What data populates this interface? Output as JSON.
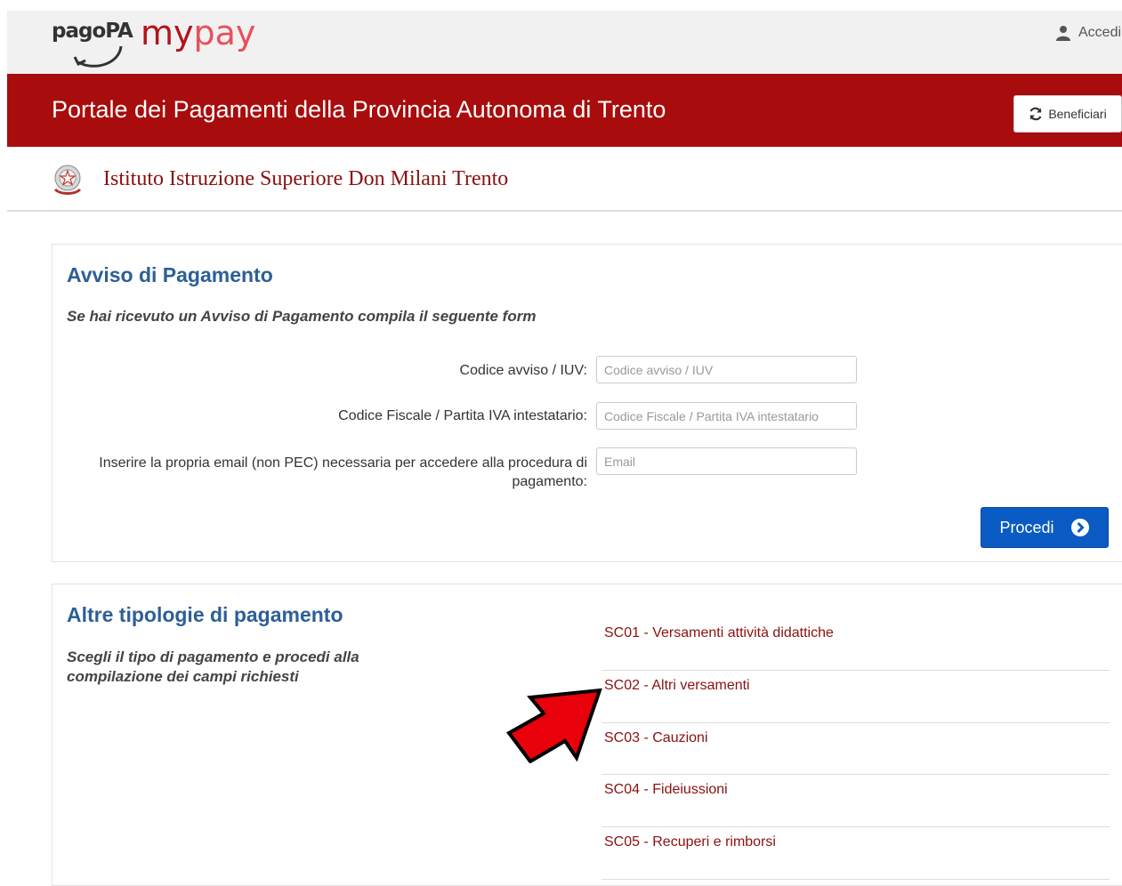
{
  "header": {
    "brand_pagopa": "pagoPA",
    "brand_my": "my",
    "brand_pay": "pay",
    "login_label": "Accedi",
    "login_icon": "user-icon"
  },
  "portal": {
    "title": "Portale dei Pagamenti della Provincia Autonoma di Trento",
    "beneficiari_label": "Beneficiari",
    "beneficiari_icon": "refresh-icon"
  },
  "institution": {
    "name": "Istituto Istruzione Superiore Don Milani Trento",
    "emblem_icon": "italian-republic-emblem-icon"
  },
  "avviso": {
    "title": "Avviso di Pagamento",
    "subtitle": "Se hai ricevuto un Avviso di Pagamento compila il seguente form",
    "fields": {
      "iuv": {
        "label": "Codice avviso / IUV:",
        "placeholder": "Codice avviso / IUV",
        "value": ""
      },
      "codice_fiscale": {
        "label": "Codice Fiscale / Partita IVA intestatario:",
        "placeholder": "Codice Fiscale / Partita IVA intestatario",
        "value": ""
      },
      "email": {
        "label": "Inserire la propria email (non PEC) necessaria per accedere alla procedura di pagamento:",
        "placeholder": "Email",
        "value": ""
      }
    },
    "submit_label": "Procedi",
    "submit_icon": "chevron-right-circle-icon"
  },
  "altre": {
    "title": "Altre tipologie di pagamento",
    "subtitle": "Scegli il tipo di pagamento e procedi alla compilazione dei campi richiesti",
    "items": [
      {
        "label": "SC01 - Versamenti attività didattiche"
      },
      {
        "label": "SC02 - Altri versamenti"
      },
      {
        "label": "SC03 - Cauzioni"
      },
      {
        "label": "SC04 - Fideiussioni"
      },
      {
        "label": "SC05 - Recuperi e rimborsi"
      }
    ]
  },
  "colors": {
    "header_red": "#a80c0c",
    "link_red": "#8b1010",
    "title_blue": "#2d5f96",
    "button_blue": "#0a5bc4",
    "annotation_arrow": "#e8000b"
  }
}
